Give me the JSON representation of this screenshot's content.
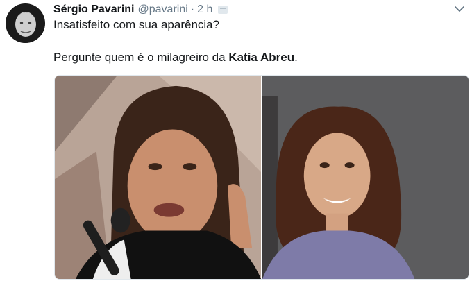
{
  "tweet": {
    "author_name": "Sérgio Pavarini",
    "author_handle": "@pavarini",
    "separator": "·",
    "time": "2 h",
    "text_line1": "Insatisfeito com sua aparência?",
    "text_line2_prefix": "Pergunte quem é o milagreiro da ",
    "text_line2_bold": "Katia Abreu",
    "text_line2_suffix": "."
  },
  "icons": {
    "menu": "chevron-down-icon",
    "extra": "tweet-extra-icon"
  },
  "colors": {
    "text": "#14171a",
    "secondary": "#657786",
    "border": "#e1e8ed"
  }
}
